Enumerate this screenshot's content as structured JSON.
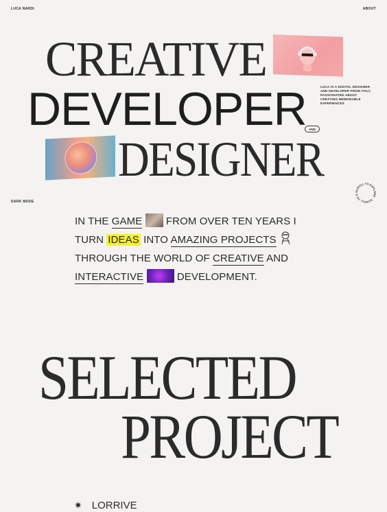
{
  "header": {
    "brand": "LUCA NARDI",
    "nav_about": "ABOUT"
  },
  "hero": {
    "line1": "CREATIVE",
    "line2": "DEVELOPER",
    "line3": "DESIGNER",
    "and_label": "AND",
    "intro": "LUCA IS A DIGITAL DESIGNER AND DEVELOPER FROM ITALY, PASSIONATED ABOUT CREATING MEMORABLE EXPERIENCES"
  },
  "controls": {
    "dark_mode": "DARK MODE"
  },
  "badge": {
    "text": "SCROLL TO EXPLORE · SCROLL TO EXPLORE ·"
  },
  "story": {
    "p1": "IN THE ",
    "game": "GAME",
    "p2": " FROM OVER TEN YEARS I",
    "p3": "TURN ",
    "ideas": "IDEAS",
    "p4": " INTO ",
    "amazing": "AMAZING PROJECTS",
    "p5": "THROUGH THE WORLD OF ",
    "creative": "CREATIVE",
    "p6": " AND",
    "interactive": "INTERACTIVE",
    "p7": " DEVELOPMENT."
  },
  "section": {
    "title1": "SELECTED",
    "title2": "PROJECT"
  },
  "projects": [
    {
      "name": "LORRIVE"
    }
  ],
  "colors": {
    "background": "#f4f3f1",
    "highlight": "#f4f22e",
    "text": "#2a2a2a"
  }
}
